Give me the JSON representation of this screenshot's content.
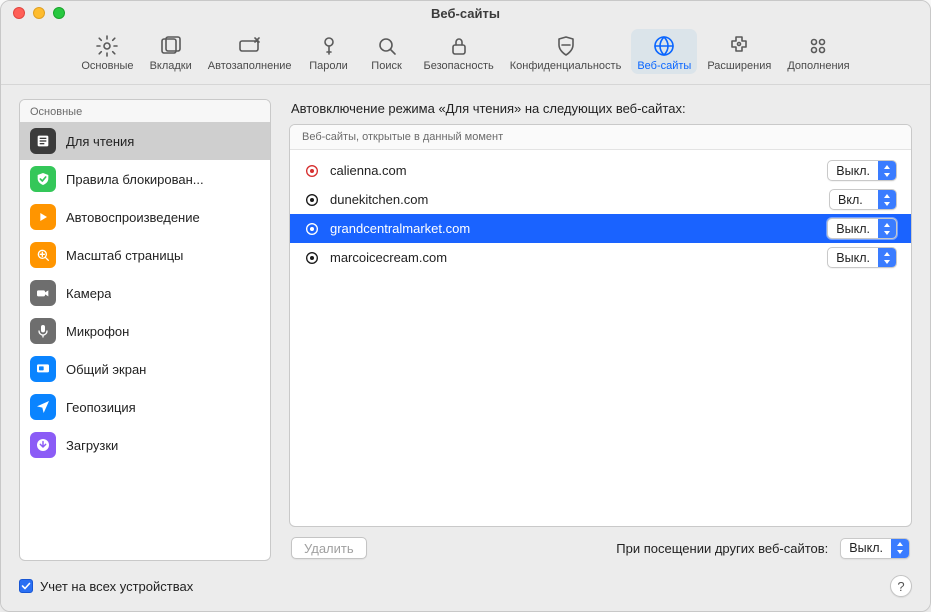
{
  "window": {
    "title": "Веб-сайты"
  },
  "toolbar": {
    "items": [
      {
        "id": "general",
        "label": "Основные"
      },
      {
        "id": "tabs",
        "label": "Вкладки"
      },
      {
        "id": "autofill",
        "label": "Автозаполнение"
      },
      {
        "id": "passwords",
        "label": "Пароли"
      },
      {
        "id": "search",
        "label": "Поиск"
      },
      {
        "id": "security",
        "label": "Безопасность"
      },
      {
        "id": "privacy",
        "label": "Конфиденциальность"
      },
      {
        "id": "websites",
        "label": "Веб-сайты",
        "selected": true
      },
      {
        "id": "extensions",
        "label": "Расширения"
      },
      {
        "id": "advanced",
        "label": "Дополнения"
      }
    ]
  },
  "sidebar": {
    "section_label": "Основные",
    "items": [
      {
        "id": "reader",
        "label": "Для чтения",
        "bg": "#3b3b3b",
        "selected": true
      },
      {
        "id": "blockers",
        "label": "Правила блокирован...",
        "bg": "#34c759"
      },
      {
        "id": "autoplay",
        "label": "Автовоспроизведение",
        "bg": "#ff9500"
      },
      {
        "id": "zoom",
        "label": "Масштаб страницы",
        "bg": "#ff9500"
      },
      {
        "id": "camera",
        "label": "Камера",
        "bg": "#6e6e6e"
      },
      {
        "id": "microphone",
        "label": "Микрофон",
        "bg": "#6e6e6e"
      },
      {
        "id": "screen",
        "label": "Общий экран",
        "bg": "#0a84ff"
      },
      {
        "id": "location",
        "label": "Геопозиция",
        "bg": "#0a84ff"
      },
      {
        "id": "downloads",
        "label": "Загрузки",
        "bg": "#8b5cf6"
      }
    ]
  },
  "main": {
    "heading": "Автовключение режима «Для чтения» на следующих веб-сайтах:",
    "open_section_label": "Веб-сайты, открытые в данный момент",
    "rows": [
      {
        "domain": "calienna.com",
        "value": "Выкл.",
        "icon_color": "#d62f2f"
      },
      {
        "domain": "dunekitchen.com",
        "value": "Вкл.",
        "icon_color": "#1a1a1a"
      },
      {
        "domain": "grandcentralmarket.com",
        "value": "Выкл.",
        "icon_color": "#0b2b5a",
        "selected": true
      },
      {
        "domain": "marcoicecream.com",
        "value": "Выкл.",
        "icon_color": "#1a1a1a"
      }
    ],
    "delete_label": "Удалить",
    "footer_label": "При посещении других веб-сайтов:",
    "footer_value": "Выкл."
  },
  "bottom": {
    "sync_label": "Учет на всех устройствах",
    "sync_checked": true,
    "help_label": "?"
  }
}
